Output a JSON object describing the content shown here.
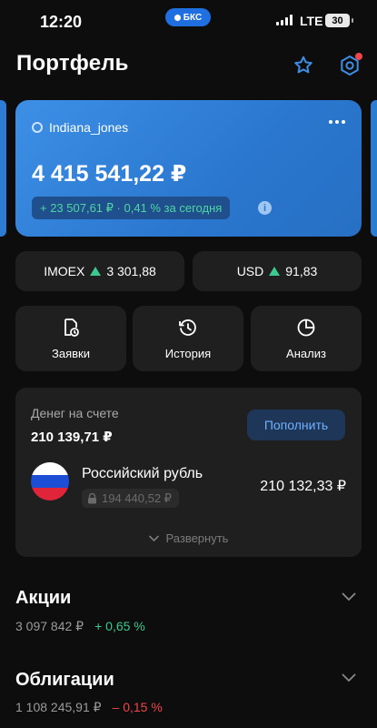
{
  "status_bar": {
    "time": "12:20",
    "pill_label": "БКС",
    "network": "LTE",
    "battery": "30"
  },
  "header": {
    "title": "Портфель"
  },
  "portfolio_card": {
    "username": "Indiana_jones",
    "total": "4 415 541,22 ₽",
    "daily_change": "+ 23 507,61 ₽ · 0,41 % за сегодня",
    "info_icon": "i"
  },
  "tickers": [
    {
      "name": "IMOEX",
      "value": "3 301,88",
      "direction": "up"
    },
    {
      "name": "USD",
      "value": "91,83",
      "direction": "up"
    }
  ],
  "actions": [
    {
      "label": "Заявки",
      "icon": "orders-icon"
    },
    {
      "label": "История",
      "icon": "history-icon"
    },
    {
      "label": "Анализ",
      "icon": "analysis-icon"
    }
  ],
  "cash": {
    "label": "Денег на счете",
    "amount": "210 139,71 ₽",
    "topup_label": "Пополнить",
    "currency_name": "Российский рубль",
    "locked_amount": "194 440,52 ₽",
    "currency_amount": "210 132,33 ₽",
    "expand_label": "Развернуть"
  },
  "sections": {
    "stocks": {
      "title": "Акции",
      "value": "3 097 842 ₽",
      "change": "+ 0,65 %"
    },
    "bonds": {
      "title": "Облигации",
      "value": "1 108 245,91 ₽",
      "change": "– 0,15 %"
    }
  },
  "colors": {
    "background": "#0d0d0d",
    "card_blue": "#2a77cf",
    "positive": "#3bc98f",
    "negative": "#f0454c",
    "accent_link": "#6fb0ff"
  }
}
